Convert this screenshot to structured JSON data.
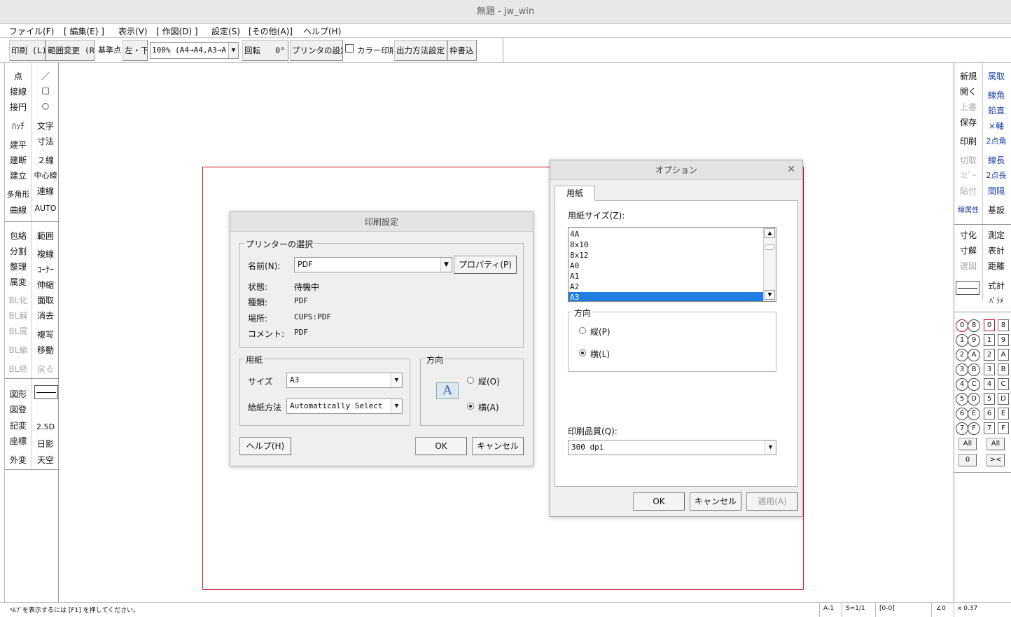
{
  "window": {
    "title": "無題 - jw_win"
  },
  "menu": [
    "ファイル(F)",
    "[ 編集(E) ]",
    "表示(V)",
    "[ 作図(D) ]",
    "設定(S)",
    "[その他(A)]",
    "ヘルプ(H)"
  ],
  "toolbar": {
    "print_label": "印刷 (L)",
    "range_label": "範囲変更 (R",
    "base_label": "基準点",
    "base_value": "左・下",
    "scale_value": "100% (A4→A4,A3→A",
    "rotate_label": "回転",
    "rotate_value": "0°",
    "printer_settings_label": "プリンタの設定",
    "color_print_label": "カラー印刷",
    "output_method_label": "出力方法設定",
    "frame_label": "枠書込"
  },
  "left_tools": {
    "col1": [
      "点",
      "接線",
      "接円",
      "ﾊｯﾁ",
      "建平",
      "建断",
      "建立",
      "多角形",
      "曲線",
      "包絡",
      "分割",
      "整理",
      "属変",
      "BL化",
      "BL解",
      "BL属",
      "BL編",
      "BL終",
      "図形",
      "図登",
      "記変",
      "座標",
      "外変"
    ],
    "col2": [
      "／",
      "□",
      "○",
      "文字",
      "寸法",
      "２線",
      "中心線",
      "連線",
      "AUTO",
      "範囲",
      "複線",
      "ｺｰﾅｰ",
      "伸縮",
      "面取",
      "消去",
      "複写",
      "移動",
      "戻る",
      "2.5D",
      "日影",
      "天空"
    ]
  },
  "right_tools": {
    "col1": [
      "新規",
      "開く",
      "上書",
      "保存",
      "印刷",
      "切取",
      "ｺﾋﾟｰ",
      "貼付",
      "線属性",
      "寸化",
      "寸解",
      "選図"
    ],
    "col2": [
      "属取",
      "線角",
      "鉛直",
      "×軸",
      "2点角",
      "線長",
      "2点長",
      "間隔",
      "基設",
      "測定",
      "表計",
      "距離",
      "式計",
      "ﾊﾟﾗﾒ"
    ],
    "layer_group_labels": [
      "0",
      "1",
      "2",
      "3",
      "4",
      "5",
      "6",
      "7"
    ],
    "layer_group_labels_2": [
      "8",
      "9",
      "A",
      "B",
      "C",
      "D",
      "E",
      "F"
    ],
    "layer_labels": [
      "0",
      "1",
      "2",
      "3",
      "4",
      "5",
      "6",
      "7"
    ],
    "layer_labels_2": [
      "8",
      "9",
      "A",
      "B",
      "C",
      "D",
      "E",
      "F"
    ],
    "all_left": "All",
    "all_right": "All",
    "zero_label": "0",
    "arrows_label": "><"
  },
  "print_dialog": {
    "title": "印刷設定",
    "printer_group": "プリンターの選択",
    "name_label": "名前(N):",
    "name_value": "PDF",
    "properties_button": "プロパティ(P)",
    "status_label": "状態:",
    "status_value": "待機中",
    "type_label": "種類:",
    "type_value": "PDF",
    "location_label": "場所:",
    "location_value": "CUPS:PDF",
    "comment_label": "コメント:",
    "comment_value": "PDF",
    "paper_group": "用紙",
    "size_label": "サイズ",
    "size_value": "A3",
    "source_label": "給紙方法",
    "source_value": "Automatically Select",
    "orientation_group": "方向",
    "orientation_icon": "A",
    "portrait_label": "縦(O)",
    "landscape_label": "横(A)",
    "orientation_selected": "landscape",
    "help_button": "ヘルプ(H)",
    "ok_button": "OK",
    "cancel_button": "キャンセル"
  },
  "options_dialog": {
    "title": "オプション",
    "tab_paper": "用紙",
    "paper_size_label": "用紙サイズ(Z):",
    "paper_sizes": [
      "4A",
      "8x10",
      "8x12",
      "A0",
      "A1",
      "A2",
      "A3"
    ],
    "paper_size_selected": "A3",
    "orientation_group": "方向",
    "portrait_label": "縦(P)",
    "landscape_label": "横(L)",
    "orientation_selected": "landscape",
    "quality_label": "印刷品質(Q):",
    "quality_value": "300 dpi",
    "ok_button": "OK",
    "cancel_button": "キャンセル",
    "apply_button": "適用(A)"
  },
  "statusbar": {
    "help_text": "ﾍﾙﾌﾟを表示するには [F1] を押してください。",
    "paper": "A-1",
    "scale": "S=1/1",
    "layer": "[0-0]",
    "angle": "∠0",
    "zoom": "x 0.37"
  },
  "colors": {
    "paper_frame": "#c8101e",
    "selection": "#1e7fe0",
    "accent_blue": "#1a3fa8"
  }
}
